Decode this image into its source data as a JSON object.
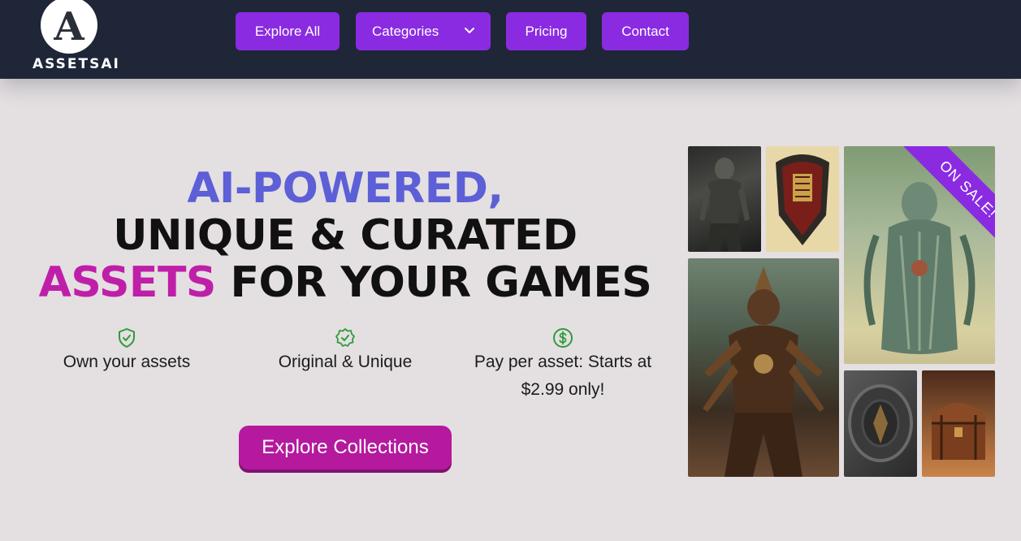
{
  "brand": {
    "logo_letter": "A",
    "name": "ASSETSAI"
  },
  "nav": {
    "explore_all": "Explore All",
    "categories": "Categories",
    "pricing": "Pricing",
    "contact": "Contact"
  },
  "hero": {
    "line1": "AI-POWERED,",
    "line2": "UNIQUE & CURATED",
    "line3_highlight": "ASSETS",
    "line3_rest": " FOR YOUR GAMES"
  },
  "features": [
    {
      "icon": "shield-check-icon",
      "text": "Own your assets"
    },
    {
      "icon": "badge-check-icon",
      "text": "Original & Unique"
    },
    {
      "icon": "dollar-icon",
      "text": "Pay per asset: Starts at $2.99 only!"
    }
  ],
  "cta": {
    "label": "Explore Collections"
  },
  "gallery": {
    "ribbon": "ON SALE!",
    "images": [
      "armor-figure",
      "ornate-shield",
      "multi-armed-warrior",
      "robed-deity-statue",
      "round-shield",
      "treasure-chest"
    ]
  },
  "colors": {
    "navbar": "#1e2638",
    "nav_button": "#8a2be2",
    "headline_blue": "#5c5fd6",
    "headline_pink": "#bf1fa8",
    "cta": "#b5199e",
    "feature_icon": "#2e9b3a",
    "background": "#e4dfe1"
  }
}
